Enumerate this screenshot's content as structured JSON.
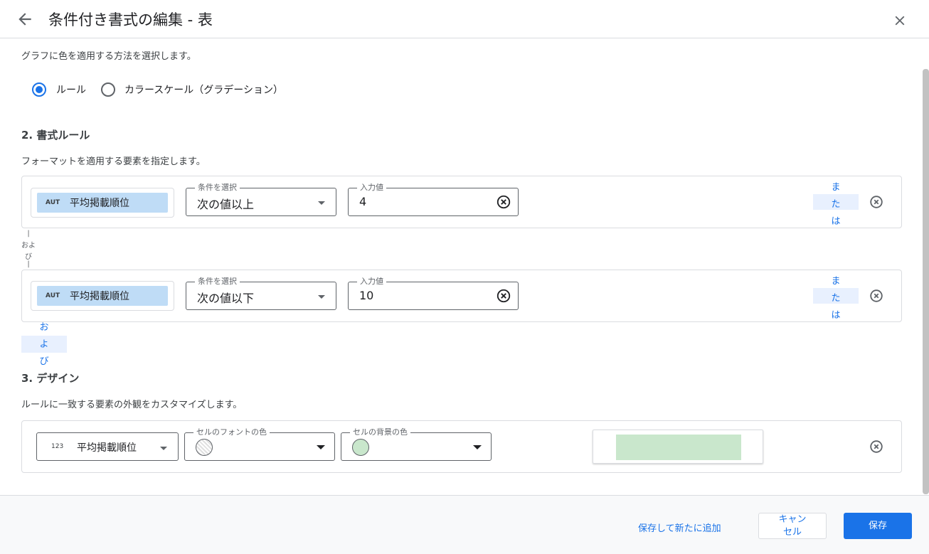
{
  "header": {
    "title": "条件付き書式の編集 - 表"
  },
  "section1": {
    "description": "グラフに色を適用する方法を選択します。",
    "radio_rule": "ルール",
    "radio_color_scale": "カラースケール（グラデーション）",
    "selected": "ルール"
  },
  "section2": {
    "heading": "2. 書式ルール",
    "description": "フォーマットを適用する要素を指定します。",
    "rules": [
      {
        "field_tag": "AUT",
        "field_name": "平均掲載順位",
        "condition_label": "条件を選択",
        "condition_value": "次の値以上",
        "input_label": "入力値",
        "input_value": "4",
        "or_text": [
          "ま",
          "た",
          "は"
        ]
      },
      {
        "field_tag": "AUT",
        "field_name": "平均掲載順位",
        "condition_label": "条件を選択",
        "condition_value": "次の値以下",
        "input_label": "入力値",
        "input_value": "10",
        "or_text": [
          "ま",
          "た",
          "は"
        ]
      }
    ],
    "and_connector": [
      "|",
      "およ",
      "び",
      "|"
    ],
    "and_button": [
      "お",
      "よ",
      "び"
    ]
  },
  "section3": {
    "heading": "3. デザイン",
    "description": "ルールに一致する要素の外観をカスタマイズします。",
    "field_tag": "123",
    "field_name": "平均掲載順位",
    "font_color_label": "セルのフォントの色",
    "bg_color_label": "セルの背景の色",
    "bg_color": "#c9e7cc",
    "preview_fill": "#c9e7cc"
  },
  "footer": {
    "save_and_add": "保存して新たに追加",
    "cancel_line1": "キャン",
    "cancel_line2": "セル",
    "save": "保存"
  },
  "colors": {
    "accent": "#1a73e8",
    "chip": "#bfdcf6",
    "or_bg": "#e8f0fe"
  }
}
